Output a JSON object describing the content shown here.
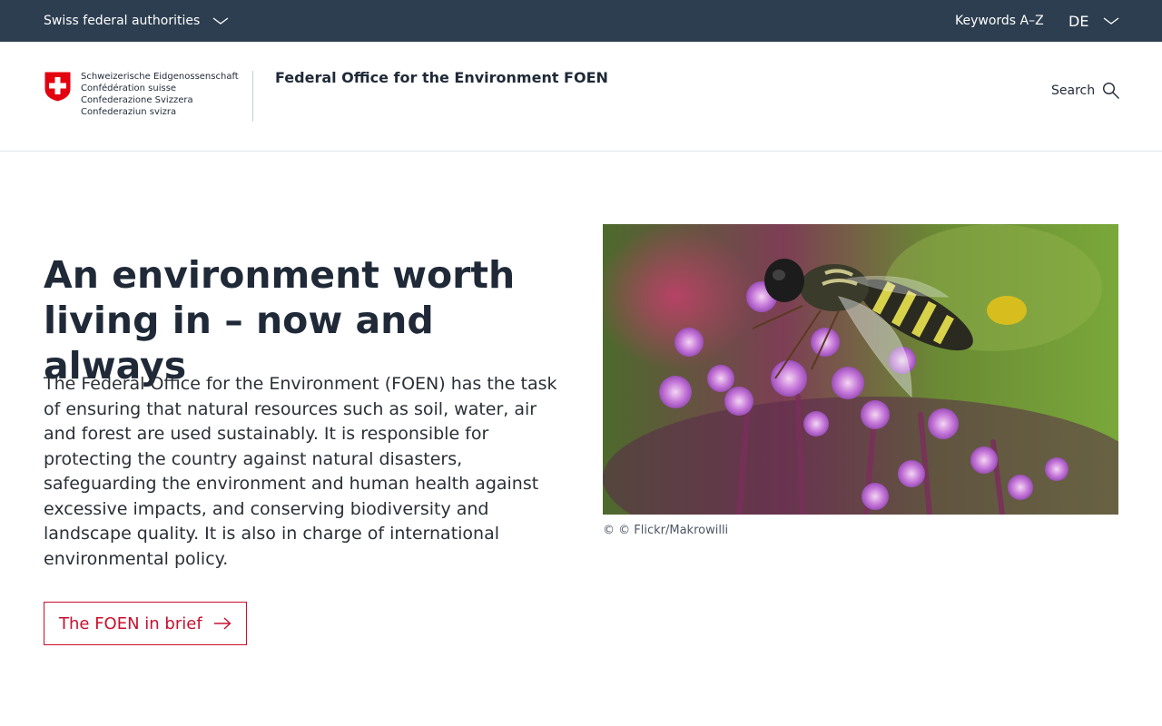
{
  "topbar": {
    "authorities_label": "Swiss federal authorities",
    "keywords_label": "Keywords A–Z",
    "language": "DE"
  },
  "header": {
    "logo_lines": [
      "Schweizerische Eidgenossenschaft",
      "Confédération suisse",
      "Confederazione Svizzera",
      "Confederaziun svizra"
    ],
    "department": "Federal Office for the Environment FOEN",
    "search_label": "Search"
  },
  "hero": {
    "title": "An environment worth living in – now and always",
    "text": "The Federal Office for the Environment (FOEN) has the task of ensuring that natural resources such as soil, water, air and forest are used sustainably. It is responsible for protecting the country against natural disasters, safeguarding the environment and human health against excessive impacts, and conserving biodiversity and landscape quality. It is also in charge of international environmental policy.",
    "cta_label": "The FOEN in brief",
    "image_caption": "© © Flickr/Makrowilli"
  },
  "colors": {
    "topbar_bg": "#2d3e50",
    "accent_red": "#c8102e",
    "text_dark": "#1f2937"
  },
  "icons": {
    "authorities_toggle": "chevron-down-icon",
    "language_toggle": "chevron-down-icon",
    "search": "search-icon",
    "cta": "arrow-right-icon",
    "logo": "swiss-cross-shield-icon"
  }
}
